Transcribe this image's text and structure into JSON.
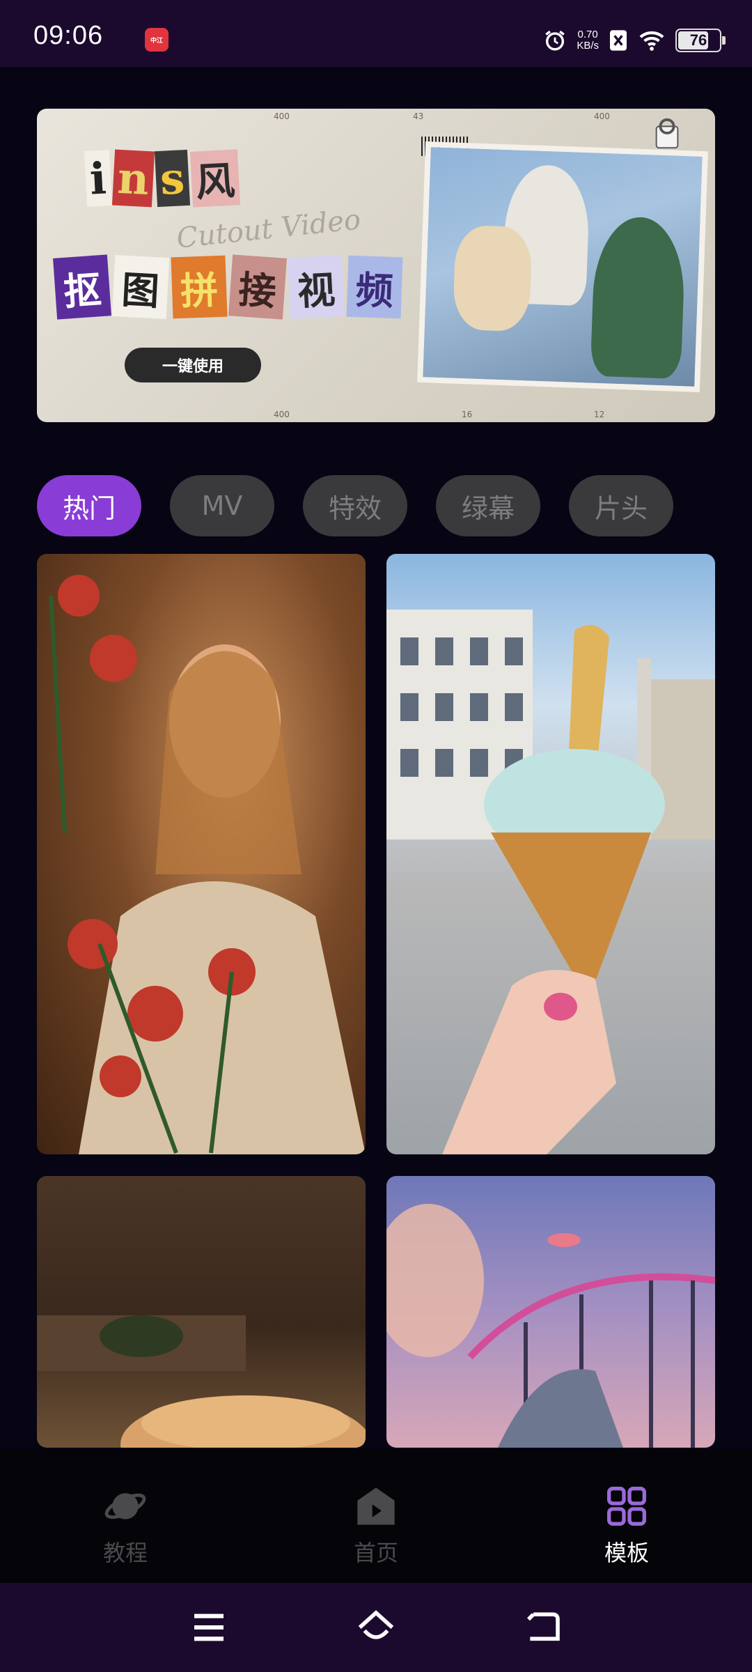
{
  "status_bar": {
    "time": "09:06",
    "app_notification": "中江",
    "net_speed_value": "0.70",
    "net_speed_unit": "KB/s",
    "battery_level": 76,
    "battery_text": "76"
  },
  "banner": {
    "title_latin": [
      "i",
      "n",
      "s"
    ],
    "title_feng": "风",
    "title_script": "Cutout Video",
    "title_cn": [
      "抠",
      "图",
      "拼",
      "接",
      "视",
      "频"
    ],
    "button_label": "一键使用",
    "ruler_marks": [
      "400",
      "43",
      "400",
      "400",
      "16",
      "12"
    ]
  },
  "tabs": [
    {
      "label": "热门",
      "active": true
    },
    {
      "label": "MV",
      "active": false
    },
    {
      "label": "特效",
      "active": false
    },
    {
      "label": "绿幕",
      "active": false
    },
    {
      "label": "片头",
      "active": false
    }
  ],
  "bottom_nav": [
    {
      "label": "教程",
      "icon": "planet-icon",
      "active": false
    },
    {
      "label": "首页",
      "icon": "home-play-icon",
      "active": false
    },
    {
      "label": "模板",
      "icon": "grid-icon",
      "active": true
    }
  ],
  "colors": {
    "accent": "#8a3cd6",
    "status_bar_bg": "#1c0a2e",
    "page_bg": "#070414"
  },
  "system_nav": [
    "menu-icon",
    "home-icon",
    "back-icon"
  ]
}
